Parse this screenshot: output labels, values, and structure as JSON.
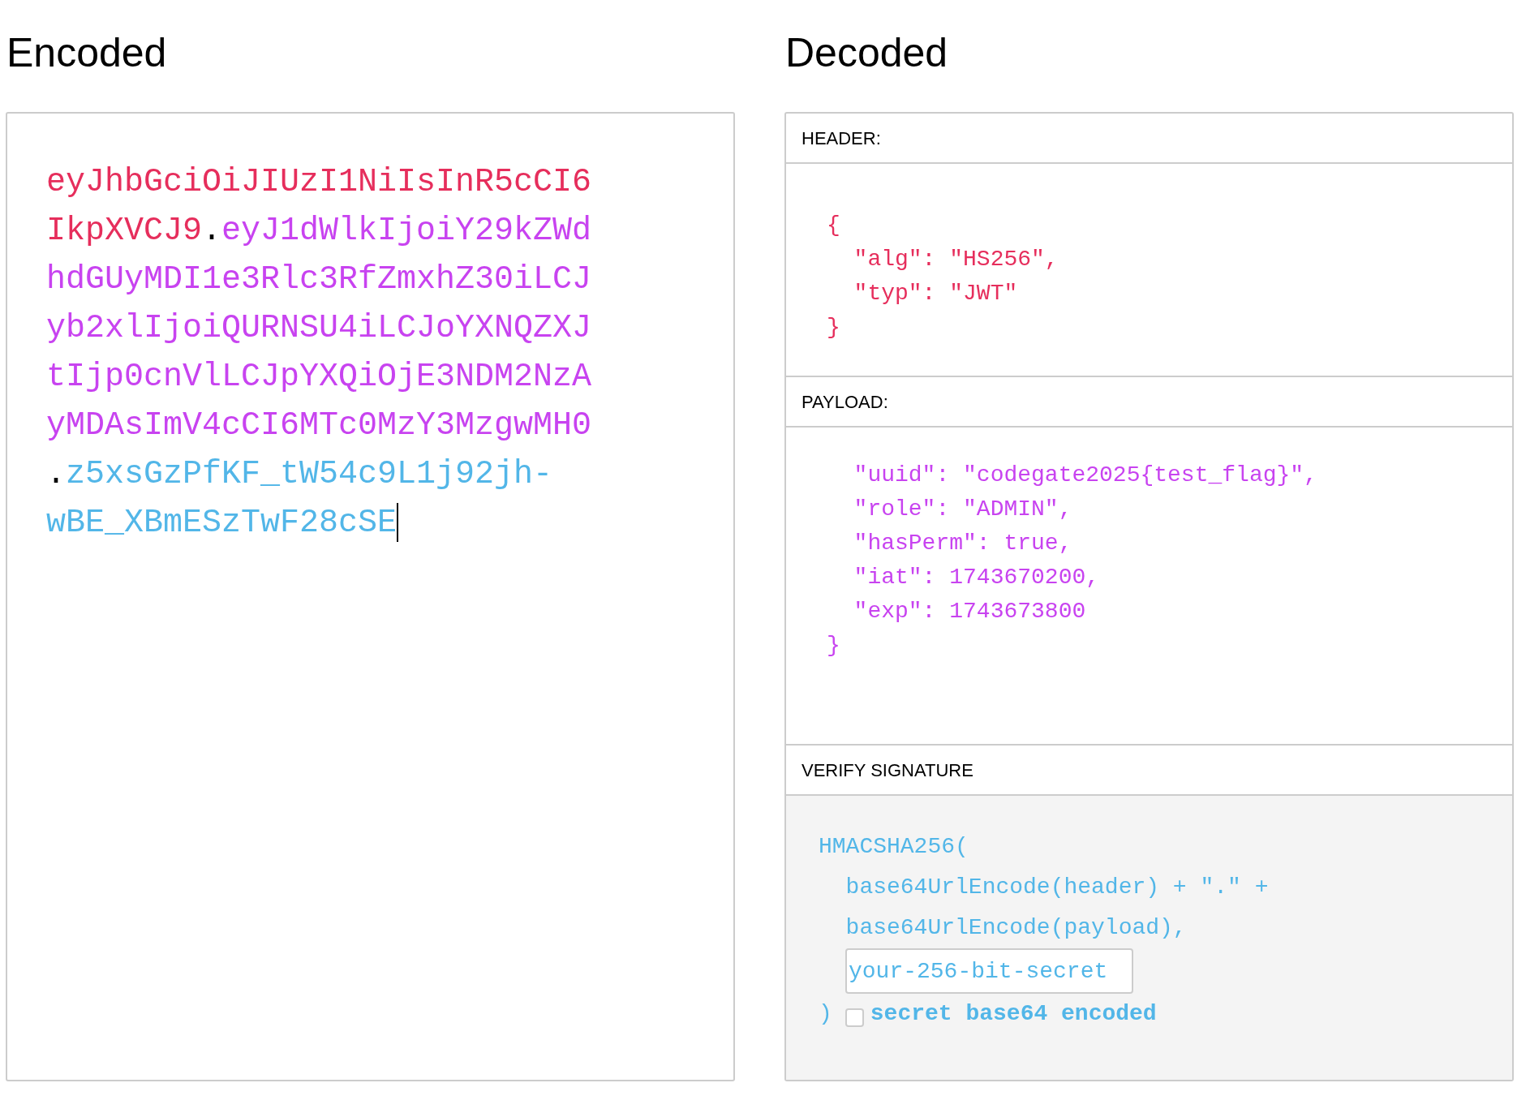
{
  "encoded": {
    "title": "Encoded",
    "focused": true,
    "segments": [
      {
        "kind": "header",
        "text": "eyJhbGciOiJIUzI1NiIsInR5cCI6IkpXVCJ9"
      },
      {
        "kind": "dot",
        "text": "."
      },
      {
        "kind": "payload",
        "text": "eyJ1dWlkIjoiY29kZWdhdGUyMDI1e3Rlc3RfZmxhZ30iLCJyb2xlIjoiQURNSU4iLCJoYXNQZXJtIjp0cnVlLCJpYXQiOjE3NDM2NzAyMDAsImV4cCI6MTc0MzY3MzgwMH0"
      },
      {
        "kind": "dot",
        "text": "."
      },
      {
        "kind": "signature",
        "text": "z5xsGzPfKF_tW54c9L1j92jh-wBE_XBmESzTwF28cSE"
      }
    ]
  },
  "decoded": {
    "title": "Decoded",
    "header": {
      "label": "HEADER:",
      "lines": [
        "{",
        "  \"alg\": \"HS256\",",
        "  \"typ\": \"JWT\"",
        "}"
      ]
    },
    "payload": {
      "label": "PAYLOAD:",
      "lines": [
        "  \"uuid\": \"codegate2025{test_flag}\",",
        "  \"role\": \"ADMIN\",",
        "  \"hasPerm\": true,",
        "  \"iat\": 1743670200,",
        "  \"exp\": 1743673800",
        "}"
      ]
    },
    "signature": {
      "label": "VERIFY SIGNATURE",
      "lines": [
        "HMACSHA256(",
        "  base64UrlEncode(header) + \".\" +",
        "  base64UrlEncode(payload),"
      ],
      "secret": {
        "value": "your-256-bit-secret"
      },
      "close": ")",
      "base64_checkbox": {
        "label": "secret base64 encoded",
        "checked": false
      }
    }
  }
}
